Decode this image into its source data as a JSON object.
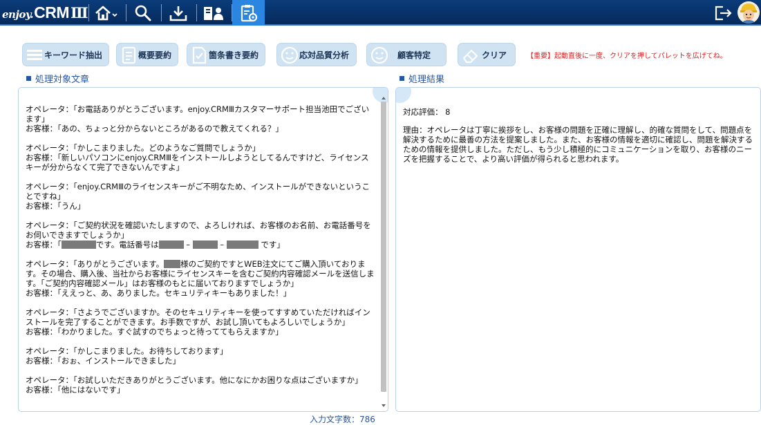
{
  "app": {
    "logo_enjoy": "enjoy.",
    "logo_crm": "CRM",
    "logo_version": "Ⅲ"
  },
  "nav": {
    "icons": [
      "home-icon",
      "search-icon",
      "download-icon",
      "contacts-icon",
      "clipboard-settings-icon"
    ],
    "active": "clipboard-settings-icon",
    "right_icons": [
      "logout-icon",
      "avatar"
    ]
  },
  "toolbar": {
    "keyword_label": "キーワード抽出",
    "summary_label": "概要要約",
    "bullet_label": "箇条書き要約",
    "quality_label": "応対品質分析",
    "customer_label": "顧客特定",
    "clear_label": "クリア",
    "notice": "【重要】起動直後に一度、クリアを押してパレットを広げてね。"
  },
  "source": {
    "label": "処理対象文章",
    "lines": [
      {
        "t": "オペレータ：「お電話ありがとうございます。enjoy.CRMⅢカスタマーサポート担当池田でございます」"
      },
      {
        "t": "お客様：「あの、ちょっと分からないところがあるので教えてくれる？」"
      },
      {
        "t": ""
      },
      {
        "t": "オペレータ：「かしこまりました。どのようなご質問でしょうか」"
      },
      {
        "t": "お客様：「新しいパソコンにenjoy.CRMⅢをインストールしようとしてるんですけど、ライセンスキーが分からなくて完了できないんですよ」"
      },
      {
        "t": ""
      },
      {
        "t": "オペレータ：「enjoy.CRMⅢのライセンスキーがご不明なため、インストールができないということですね」"
      },
      {
        "t": "お客様：「うん」"
      },
      {
        "t": ""
      },
      {
        "t": "オペレータ：「ご契約状況を確認いたしますので、よろしければ、お客様のお名前、お電話番号をお伺いできますでしょうか」"
      },
      {
        "t": "お客様：「[R50]です。電話番号は[R36] – [R36] – [R46] です」"
      },
      {
        "t": ""
      },
      {
        "t": "オペレータ：「ありがとうございます。[R24]様のご契約ですとWEB注文にてご購入頂いております。その場合、購入後、当社からお客様にライセンスキーを含むご契約内容確認メールを送信します。「ご契約内容確認メール」はお客様のもとに届いておりますでしょうか」"
      },
      {
        "t": "お客様：「ええっと、あ、ありました。セキュリティキーもありました！」"
      },
      {
        "t": ""
      },
      {
        "t": "オペレータ：「さようでございますか。そのセキュリティキーを使ってすすめていただければインストールを完了することができます。お手数ですが、お試し頂いてもよろしいでしょうか」"
      },
      {
        "t": "お客様：「わかりました。すぐ試すのでちょっと待っててもらえますか」"
      },
      {
        "t": ""
      },
      {
        "t": "オペレータ：「かしこまりました。お待ちしております」"
      },
      {
        "t": "お客様：「おぉ、インストールできました」"
      },
      {
        "t": ""
      },
      {
        "t": "オペレータ：「お試しいただきありがとうございます。他になにかお困りな点はございますか」"
      },
      {
        "t": "お客様：「他にはないです」"
      }
    ]
  },
  "result": {
    "label": "処理結果",
    "score": "対応評価： 8",
    "reason": "理由：オペレータは丁寧に挨拶をし、お客様の問題を正確に理解し、的確な質問をして、問題点を解決するために最善の方法を提案しました。また、お客様の情報を適切に確認し、問題を解決するための情報を提供しました。ただし、もう少し積極的にコミュニケーションを取り、お客様のニーズを把握することで、より高い評価が得られると思われます。"
  },
  "footer": {
    "char_count": "入力文字数：786"
  },
  "colors": {
    "nav_bg": "#062a5c",
    "nav_active": "#2a86e0",
    "button_bg": "#cfe3f3",
    "accent": "#2556a4",
    "notice": "#e02020"
  }
}
